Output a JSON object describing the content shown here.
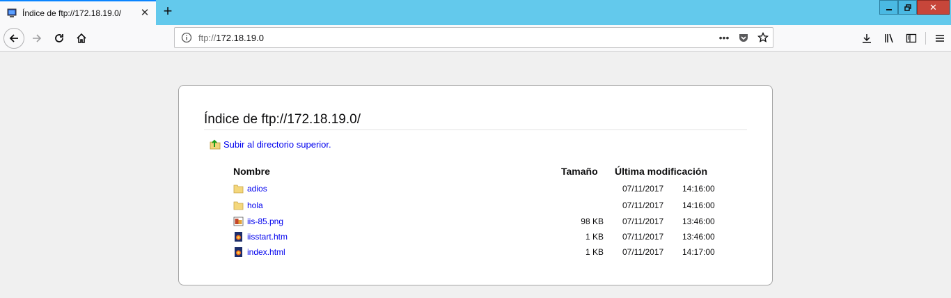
{
  "tab": {
    "title": "Índice de ftp://172.18.19.0/"
  },
  "urlbar": {
    "scheme": "ftp://",
    "host": "172.18.19.0"
  },
  "page": {
    "heading": "Índice de ftp://172.18.19.0/",
    "up_link": "Subir al directorio superior.",
    "columns": {
      "name": "Nombre",
      "size": "Tamaño",
      "modified": "Última modificación"
    },
    "files": [
      {
        "name": "adios",
        "type": "folder",
        "size": "",
        "date": "07/11/2017",
        "time": "14:16:00"
      },
      {
        "name": "hola",
        "type": "folder",
        "size": "",
        "date": "07/11/2017",
        "time": "14:16:00"
      },
      {
        "name": "iis-85.png",
        "type": "image",
        "size": "98 KB",
        "date": "07/11/2017",
        "time": "13:46:00"
      },
      {
        "name": "iisstart.htm",
        "type": "html",
        "size": "1 KB",
        "date": "07/11/2017",
        "time": "13:46:00"
      },
      {
        "name": "index.html",
        "type": "html",
        "size": "1 KB",
        "date": "07/11/2017",
        "time": "14:17:00"
      }
    ]
  },
  "colors": {
    "tabstrip": "#63c9ec",
    "link": "#0000ee",
    "close_button": "#c7463a"
  }
}
